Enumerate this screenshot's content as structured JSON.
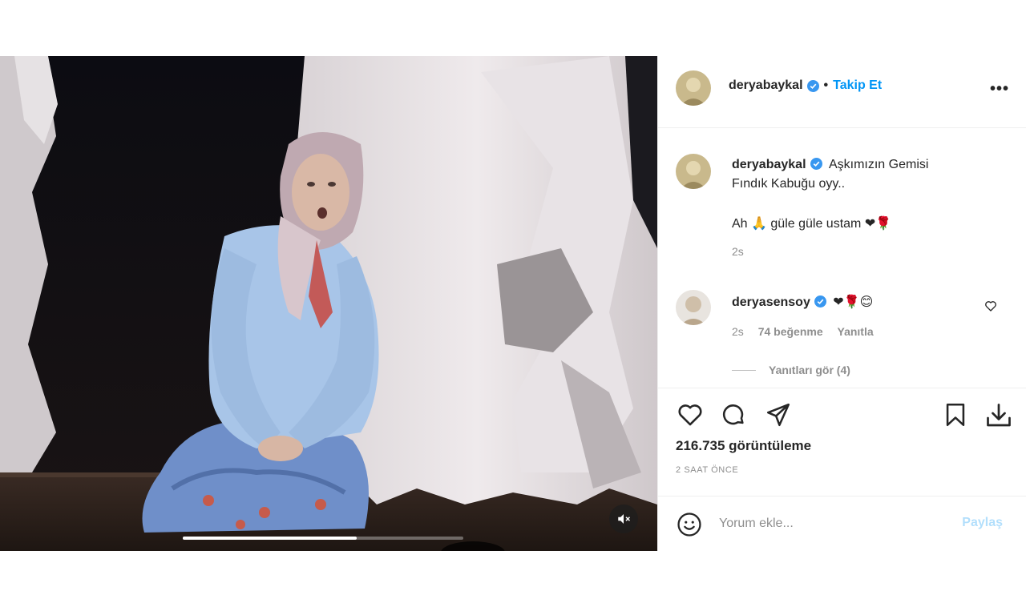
{
  "post": {
    "author": "deryabaykal",
    "follow_label": "Takip Et",
    "more_label": "•••",
    "caption_line1": "Aşkımızın Gemisi",
    "caption_line2": "Fındık Kabuğu oyy..",
    "caption_line3_prefix": "Ah",
    "caption_line3_mid": "güle güle ustam",
    "caption_time": "2s",
    "views": "216.735 görüntüleme",
    "posted_ago": "2 SAAT ÖNCE"
  },
  "comment": {
    "author": "deryasensoy",
    "emojis": "❤🌹😊",
    "time": "2s",
    "likes": "74 beğenme",
    "reply_label": "Yanıtla",
    "view_replies": "Yanıtları gör (4)"
  },
  "emoji": {
    "pray": "🙏",
    "heart_rose": "❤🌹"
  },
  "composer": {
    "placeholder": "Yorum ekle...",
    "post_label": "Paylaş"
  },
  "video": {
    "progress": 0.62,
    "muted": true
  },
  "colors": {
    "accent": "#0095f6",
    "verified": "#3897f0",
    "muted_text": "#8e8e8e",
    "post_disabled": "#b2dffc"
  },
  "icons": [
    "verified-badge-icon",
    "more-options-icon",
    "heart-icon",
    "comment-icon",
    "share-icon",
    "bookmark-icon",
    "download-icon",
    "emoji-icon",
    "mute-icon"
  ]
}
